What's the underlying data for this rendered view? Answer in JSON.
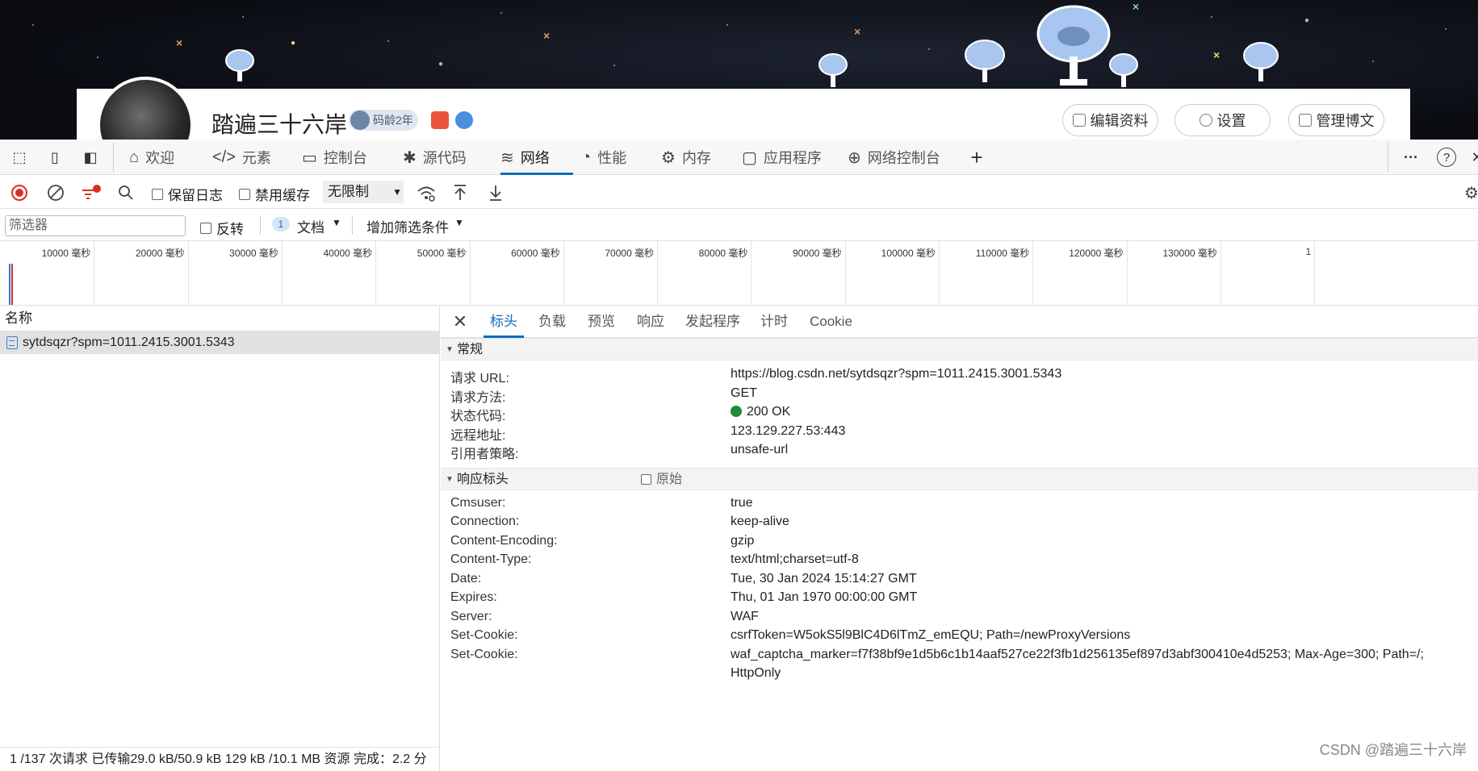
{
  "banner": {
    "username": "踏遍三十六岸",
    "age_badge": "码龄2年",
    "buttons": {
      "edit": "编辑资料",
      "settings": "设置",
      "manage": "管理博文"
    }
  },
  "devtools": {
    "tabs": [
      {
        "label": "欢迎",
        "icon": "home-icon"
      },
      {
        "label": "元素",
        "icon": "code-icon"
      },
      {
        "label": "控制台",
        "icon": "console-icon"
      },
      {
        "label": "源代码",
        "icon": "bug-icon"
      },
      {
        "label": "网络",
        "icon": "wifi-icon"
      },
      {
        "label": "性能",
        "icon": "gauge-icon"
      },
      {
        "label": "内存",
        "icon": "chip-icon"
      },
      {
        "label": "应用程序",
        "icon": "app-icon"
      },
      {
        "label": "网络控制台",
        "icon": "globe-icon"
      }
    ],
    "add_tab": "+",
    "more": "···",
    "help": "?"
  },
  "toolbar": {
    "preserve_log": "保留日志",
    "disable_cache": "禁用缓存",
    "throttling": "无限制"
  },
  "filterbar": {
    "placeholder": "筛选器",
    "invert": "反转",
    "doc_count": "1",
    "doc_label": "文档",
    "more_filters": "增加筛选条件"
  },
  "timeline": {
    "ticks": [
      "10000 毫秒",
      "20000 毫秒",
      "30000 毫秒",
      "40000 毫秒",
      "50000 毫秒",
      "60000 毫秒",
      "70000 毫秒",
      "80000 毫秒",
      "90000 毫秒",
      "100000 毫秒",
      "110000 毫秒",
      "120000 毫秒",
      "130000 毫秒",
      "1"
    ]
  },
  "requests": {
    "header": "名称",
    "rows": [
      {
        "name": "sytdsqzr?spm=1011.2415.3001.5343"
      }
    ],
    "status": "1 /137 次请求  已传输29.0 kB/50.9 kB  129 kB /10.1 MB 资源  完成：2.2 分"
  },
  "details": {
    "tabs": [
      "标头",
      "负载",
      "预览",
      "响应",
      "发起程序",
      "计时",
      "Cookie"
    ],
    "general_title": "常规",
    "general": [
      {
        "k": "请求 URL:",
        "v": "https://blog.csdn.net/sytdsqzr?spm=1011.2415.3001.5343"
      },
      {
        "k": "请求方法:",
        "v": "GET"
      },
      {
        "k": "状态代码:",
        "v": "200 OK",
        "status_color": "#1e8a3a"
      },
      {
        "k": "远程地址:",
        "v": "123.129.227.53:443"
      },
      {
        "k": "引用者策略:",
        "v": "unsafe-url"
      }
    ],
    "response_title": "响应标头",
    "raw_label": "原始",
    "response": [
      {
        "k": "Cmsuser:",
        "v": "true"
      },
      {
        "k": "Connection:",
        "v": "keep-alive"
      },
      {
        "k": "Content-Encoding:",
        "v": "gzip"
      },
      {
        "k": "Content-Type:",
        "v": "text/html;charset=utf-8"
      },
      {
        "k": "Date:",
        "v": "Tue, 30 Jan 2024 15:14:27 GMT"
      },
      {
        "k": "Expires:",
        "v": "Thu, 01 Jan 1970 00:00:00 GMT"
      },
      {
        "k": "Server:",
        "v": "WAF"
      },
      {
        "k": "Set-Cookie:",
        "v": "csrfToken=W5okS5l9BlC4D6lTmZ_emEQU; Path=/newProxyVersions"
      },
      {
        "k": "Set-Cookie:",
        "v": "waf_captcha_marker=f7f38bf9e1d5b6c1b14aaf527ce22f3fb1d256135ef897d3abf300410e4d5253; Max-Age=300; Path=/;"
      },
      {
        "k": "",
        "v": "HttpOnly"
      }
    ]
  },
  "watermark": "CSDN @踏遍三十六岸"
}
